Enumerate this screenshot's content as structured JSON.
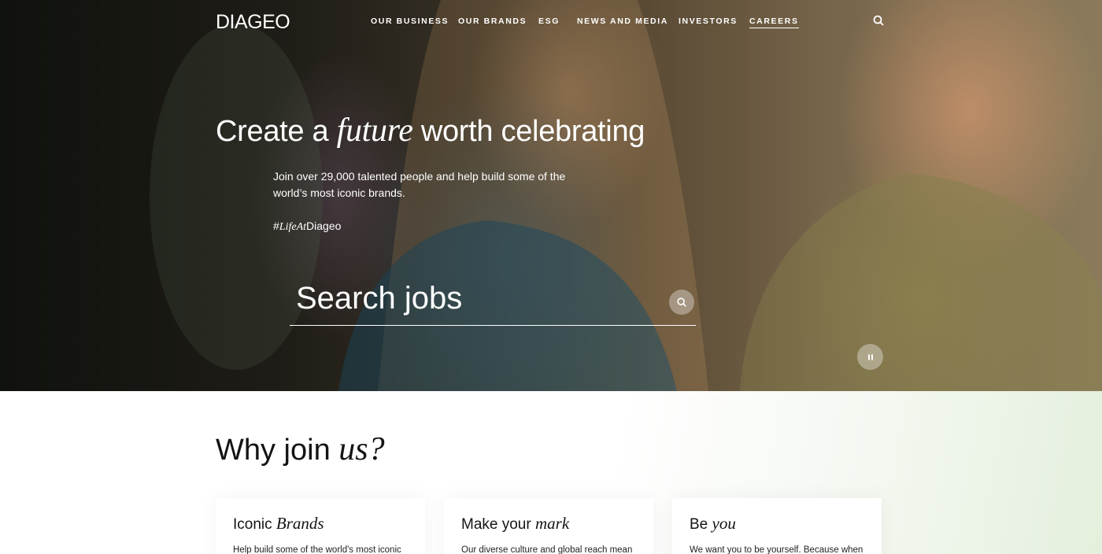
{
  "brand": {
    "logo": "DIAGEO"
  },
  "nav": {
    "items": [
      {
        "label": "OUR BUSINESS",
        "active": false
      },
      {
        "label": "OUR BRANDS",
        "active": false
      },
      {
        "label": "ESG",
        "active": false
      },
      {
        "label": "NEWS AND MEDIA",
        "active": false
      },
      {
        "label": "INVESTORS",
        "active": false
      },
      {
        "label": "CAREERS",
        "active": true
      }
    ],
    "search_icon": "search-icon"
  },
  "hero": {
    "title_pre": "Create a ",
    "title_em": "future",
    "title_post": " worth celebrating",
    "subtitle": "Join over 29,000 talented people and help build some of the world’s most iconic brands.",
    "hashtag_pre": "#",
    "hashtag_em": "LifeAt",
    "hashtag_post": "Diageo",
    "search_placeholder": "Search jobs",
    "search_button_icon": "search-icon",
    "pause_icon": "pause-icon"
  },
  "why": {
    "title_pre": "Why join ",
    "title_em": "us?",
    "cards": [
      {
        "title_pre": "Iconic ",
        "title_em": "Brands",
        "body": "Help build some of the world's most iconic"
      },
      {
        "title_pre": "Make your ",
        "title_em": "mark",
        "body": "Our diverse culture and global reach mean"
      },
      {
        "title_pre": "Be ",
        "title_em": "you",
        "body": "We want you to be yourself. Because when"
      }
    ]
  },
  "colors": {
    "text_dark": "#141414",
    "white": "#ffffff",
    "mint": "#e4efdc"
  }
}
